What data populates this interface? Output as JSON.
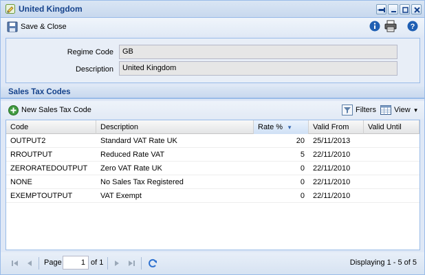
{
  "window": {
    "title": "United Kingdom"
  },
  "toolbar": {
    "save_close_label": "Save & Close"
  },
  "form": {
    "regime_code_label": "Regime Code",
    "regime_code_value": "GB",
    "description_label": "Description",
    "description_value": "United Kingdom"
  },
  "sales_tax": {
    "section_title": "Sales Tax Codes",
    "new_button_label": "New Sales Tax Code",
    "filters_label": "Filters",
    "view_label": "View"
  },
  "grid": {
    "columns": [
      "Code",
      "Description",
      "Rate %",
      "Valid From",
      "Valid Until"
    ],
    "rows": [
      [
        "OUTPUT2",
        "Standard VAT Rate UK",
        "20",
        "25/11/2013",
        ""
      ],
      [
        "RROUTPUT",
        "Reduced Rate VAT",
        "5",
        "22/11/2010",
        ""
      ],
      [
        "ZERORATEDOUTPUT",
        "Zero VAT Rate UK",
        "0",
        "22/11/2010",
        ""
      ],
      [
        "NONE",
        "No Sales Tax Registered",
        "0",
        "22/11/2010",
        ""
      ],
      [
        "EXEMPTOUTPUT",
        "VAT Exempt",
        "0",
        "22/11/2010",
        ""
      ]
    ]
  },
  "pager": {
    "page_label": "Page",
    "page_value": "1",
    "of_label": "of 1",
    "status": "Displaying 1 - 5 of 5"
  },
  "colors": {
    "accent": "#15428b",
    "border": "#99bbe8",
    "panel": "#dfe8f6"
  }
}
